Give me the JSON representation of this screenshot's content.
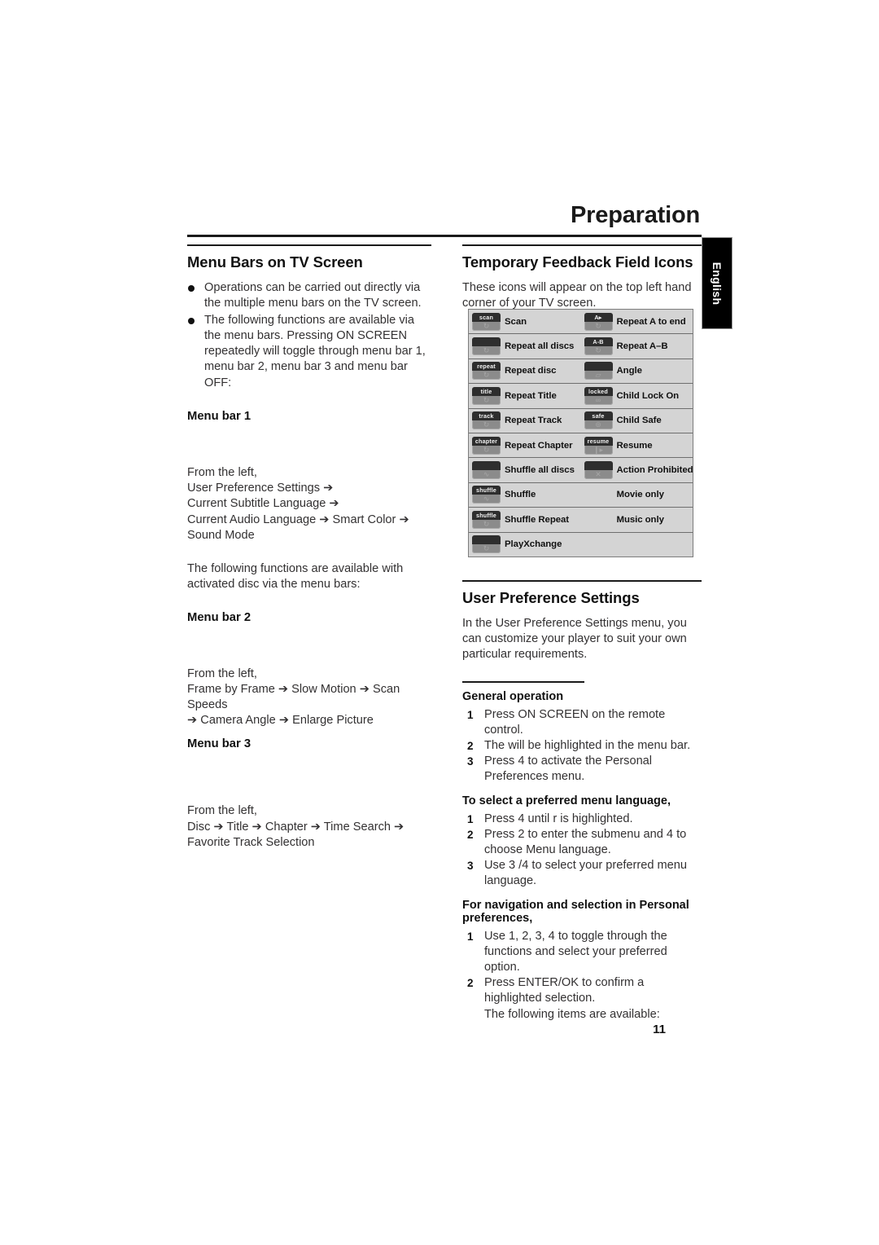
{
  "header": {
    "title": "Preparation",
    "language_tab": "English"
  },
  "footer": {
    "page_number": "11"
  },
  "left_column": {
    "section_title": "Menu Bars on TV Screen",
    "bullets": [
      "Operations can be carried out directly via the multiple menu bars on the TV screen.",
      "The following functions are available via the menu bars. Pressing ON SCREEN repeatedly will toggle through menu bar 1, menu bar 2, menu bar 3 and menu bar OFF:"
    ],
    "menu_bar_1": {
      "label": "Menu bar 1",
      "from_the_left": "From the left,",
      "chain_lines": [
        "User Preference Settings ➔",
        "Current Subtitle Language ➔",
        "Current Audio Language ➔ Smart Color ➔",
        "Sound Mode"
      ],
      "note": "The following functions are available with activated disc via the menu bars:"
    },
    "menu_bar_2": {
      "label": "Menu bar 2",
      "from_the_left": "From the left,",
      "chain_lines": [
        "Frame by Frame ➔ Slow Motion ➔ Scan Speeds",
        "➔ Camera Angle ➔ Enlarge Picture"
      ]
    },
    "menu_bar_3": {
      "label": "Menu bar 3",
      "from_the_left": "From the left,",
      "chain_lines": [
        "Disc ➔ Title ➔ Chapter ➔ Time Search ➔",
        "Favorite Track Selection"
      ]
    }
  },
  "right_column": {
    "feedback_section": {
      "title": "Temporary Feedback Field Icons",
      "intro": "These icons will appear on the top left hand corner of your TV screen.",
      "rows": [
        [
          {
            "icon_text": "scan",
            "icon_glyph": "↻",
            "label": "Scan"
          },
          {
            "icon_text": "A▸",
            "icon_glyph": "↻",
            "label": "Repeat A to end"
          }
        ],
        [
          {
            "icon_text": "",
            "icon_glyph": "↻",
            "label": "Repeat all discs"
          },
          {
            "icon_text": "A-B",
            "icon_glyph": "↻",
            "label": "Repeat A–B"
          }
        ],
        [
          {
            "icon_text": "repeat",
            "icon_glyph": "↻",
            "label": "Repeat disc"
          },
          {
            "icon_text": "",
            "icon_glyph": "▱",
            "label": "Angle"
          }
        ],
        [
          {
            "icon_text": "title",
            "icon_glyph": "↻",
            "label": "Repeat Title"
          },
          {
            "icon_text": "locked",
            "icon_glyph": "∞",
            "label": "Child Lock On"
          }
        ],
        [
          {
            "icon_text": "track",
            "icon_glyph": "↻",
            "label": "Repeat Track"
          },
          {
            "icon_text": "safe",
            "icon_glyph": "⊚",
            "label": "Child Safe"
          }
        ],
        [
          {
            "icon_text": "chapter",
            "icon_glyph": "↻",
            "label": "Repeat Chapter"
          },
          {
            "icon_text": "resume",
            "icon_glyph": "❙▸",
            "label": "Resume"
          }
        ],
        [
          {
            "icon_text": "",
            "icon_glyph": "∿",
            "label": "Shuffle all discs"
          },
          {
            "icon_text": "",
            "icon_glyph": "✕",
            "label": "Action Prohibited"
          }
        ],
        [
          {
            "icon_text": "shuffle",
            "icon_glyph": "∿",
            "label": "Shuffle"
          },
          {
            "icon_text": null,
            "icon_glyph": null,
            "label": "Movie only"
          }
        ],
        [
          {
            "icon_text": "shuffle",
            "icon_glyph": "↻",
            "label": "Shuffle Repeat"
          },
          {
            "icon_text": null,
            "icon_glyph": null,
            "label": "Music only"
          }
        ],
        [
          {
            "icon_text": "",
            "icon_glyph": "↻",
            "label": "PlayXchange"
          },
          {
            "icon_text": null,
            "icon_glyph": null,
            "label": ""
          }
        ]
      ]
    },
    "ups_section": {
      "title": "User Preference Settings",
      "intro": "In the User Preference Settings menu, you can customize your player to suit your own particular requirements.",
      "general_operation": {
        "title": "General operation",
        "steps": [
          {
            "num": "1",
            "text": "Press ON SCREEN on the remote control."
          },
          {
            "num": "2",
            "text": "The     will be highlighted in the menu bar."
          },
          {
            "num": "3",
            "text": "Press 4  to activate the Personal Preferences menu."
          }
        ]
      },
      "menu_language": {
        "title": "To select a preferred menu language,",
        "steps": [
          {
            "num": "1",
            "text": "Press 4  until r   is highlighted."
          },
          {
            "num": "2",
            "text": "Press 2  to enter the submenu and 4  to choose Menu language."
          },
          {
            "num": "3",
            "text": "Use 3 /4  to select your preferred menu language."
          }
        ]
      },
      "navigation": {
        "title": "For navigation and selection in Personal preferences,",
        "steps": [
          {
            "num": "1",
            "text": "Use 1, 2, 3, 4  to toggle through the functions and select your preferred option."
          },
          {
            "num": "2",
            "text": "Press ENTER/OK to confirm a highlighted selection."
          }
        ],
        "trailer": "The following items are available:"
      }
    }
  }
}
